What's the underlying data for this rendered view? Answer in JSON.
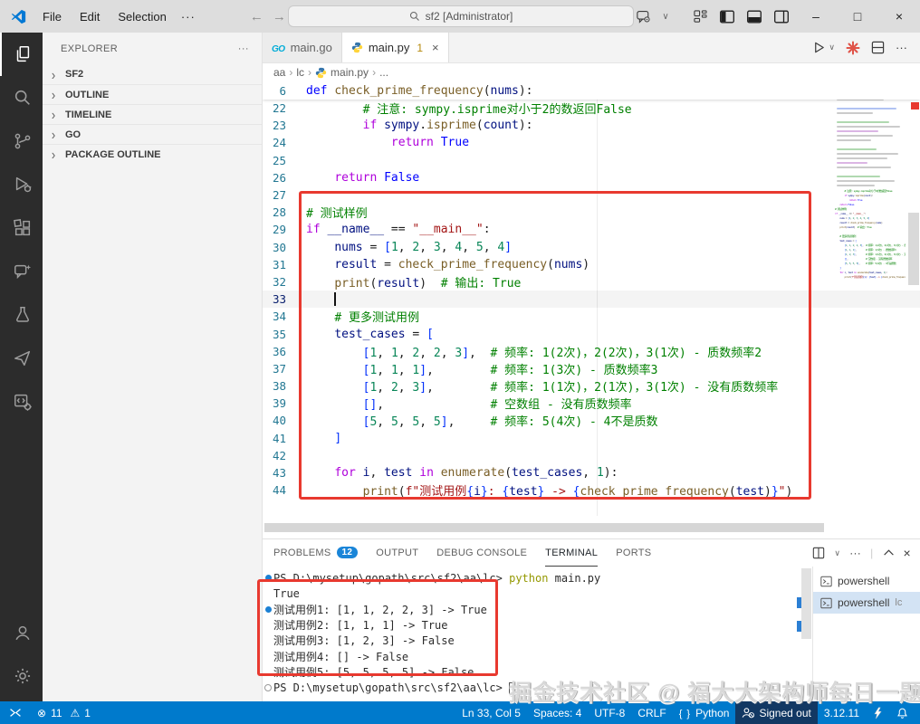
{
  "title_bar": {
    "menus": [
      "File",
      "Edit",
      "Selection"
    ],
    "menu_overflow": "···",
    "search": "sf2 [Administrator]",
    "window_buttons": [
      "minimize",
      "maximize",
      "close"
    ]
  },
  "activity_bar": {
    "items": [
      {
        "name": "explorer",
        "active": true
      },
      {
        "name": "search",
        "active": false
      },
      {
        "name": "source-control",
        "active": false
      },
      {
        "name": "run-debug",
        "active": false
      },
      {
        "name": "extensions",
        "active": false
      },
      {
        "name": "chat",
        "active": false
      },
      {
        "name": "testing",
        "active": false
      },
      {
        "name": "go",
        "active": false
      },
      {
        "name": "tools",
        "active": false
      }
    ],
    "bottom": [
      {
        "name": "accounts"
      },
      {
        "name": "settings"
      }
    ]
  },
  "sidebar": {
    "title": "EXPLORER",
    "sections": [
      "SF2",
      "OUTLINE",
      "TIMELINE",
      "GO",
      "PACKAGE OUTLINE"
    ]
  },
  "tabs": [
    {
      "label": "main.go",
      "icon": "go",
      "active": false
    },
    {
      "label": "main.py",
      "icon": "python",
      "badge": "1",
      "close": "×",
      "active": true
    }
  ],
  "breadcrumb": [
    {
      "label": "aa"
    },
    {
      "label": "lc"
    },
    {
      "label": "main.py",
      "icon": "python"
    },
    {
      "label": "..."
    }
  ],
  "editor": {
    "sticky_line": {
      "num": 6,
      "tokens": [
        [
          "k",
          "def"
        ],
        [
          "p",
          " "
        ],
        [
          "fn",
          "check_prime_frequency"
        ],
        [
          "p",
          "("
        ],
        [
          "v",
          "nums"
        ],
        [
          "p",
          "):"
        ]
      ]
    },
    "cursor_position": "Ln 33, Col 5",
    "lines": [
      {
        "num": 22,
        "tokens": [
          [
            "p",
            "        "
          ],
          [
            "c",
            "# 注意: sympy.isprime对小于2的数返回False"
          ]
        ]
      },
      {
        "num": 23,
        "tokens": [
          [
            "p",
            "        "
          ],
          [
            "f",
            "if"
          ],
          [
            "p",
            " "
          ],
          [
            "v",
            "sympy"
          ],
          [
            "p",
            "."
          ],
          [
            "fn",
            "isprime"
          ],
          [
            "p",
            "("
          ],
          [
            "v",
            "count"
          ],
          [
            "p",
            "):"
          ]
        ]
      },
      {
        "num": 24,
        "tokens": [
          [
            "p",
            "            "
          ],
          [
            "f",
            "return"
          ],
          [
            "p",
            " "
          ],
          [
            "k",
            "True"
          ]
        ]
      },
      {
        "num": 25,
        "tokens": []
      },
      {
        "num": 26,
        "tokens": [
          [
            "p",
            "    "
          ],
          [
            "f",
            "return"
          ],
          [
            "p",
            " "
          ],
          [
            "k",
            "False"
          ]
        ]
      },
      {
        "num": 27,
        "tokens": []
      },
      {
        "num": 28,
        "tokens": [
          [
            "c",
            "# 测试样例"
          ]
        ]
      },
      {
        "num": 29,
        "tokens": [
          [
            "f",
            "if"
          ],
          [
            "p",
            " "
          ],
          [
            "v",
            "__name__"
          ],
          [
            "p",
            " == "
          ],
          [
            "s",
            "\"__main__\""
          ],
          [
            "p",
            ":"
          ]
        ]
      },
      {
        "num": 30,
        "tokens": [
          [
            "p",
            "    "
          ],
          [
            "v",
            "nums"
          ],
          [
            "p",
            " = "
          ],
          [
            "b",
            "["
          ],
          [
            "n",
            "1"
          ],
          [
            "p",
            ", "
          ],
          [
            "n",
            "2"
          ],
          [
            "p",
            ", "
          ],
          [
            "n",
            "3"
          ],
          [
            "p",
            ", "
          ],
          [
            "n",
            "4"
          ],
          [
            "p",
            ", "
          ],
          [
            "n",
            "5"
          ],
          [
            "p",
            ", "
          ],
          [
            "n",
            "4"
          ],
          [
            "b",
            "]"
          ]
        ]
      },
      {
        "num": 31,
        "tokens": [
          [
            "p",
            "    "
          ],
          [
            "v",
            "result"
          ],
          [
            "p",
            " = "
          ],
          [
            "fn",
            "check_prime_frequency"
          ],
          [
            "p",
            "("
          ],
          [
            "v",
            "nums"
          ],
          [
            "p",
            ")"
          ]
        ]
      },
      {
        "num": 32,
        "tokens": [
          [
            "p",
            "    "
          ],
          [
            "fn",
            "print"
          ],
          [
            "p",
            "("
          ],
          [
            "v",
            "result"
          ],
          [
            "p",
            ")  "
          ],
          [
            "c",
            "# 输出: True"
          ]
        ]
      },
      {
        "num": 33,
        "tokens": [
          [
            "p",
            "    "
          ]
        ],
        "cursor": true,
        "active": true
      },
      {
        "num": 34,
        "tokens": [
          [
            "p",
            "    "
          ],
          [
            "c",
            "# 更多测试用例"
          ]
        ]
      },
      {
        "num": 35,
        "tokens": [
          [
            "p",
            "    "
          ],
          [
            "v",
            "test_cases"
          ],
          [
            "p",
            " = "
          ],
          [
            "b",
            "["
          ]
        ]
      },
      {
        "num": 36,
        "tokens": [
          [
            "p",
            "        "
          ],
          [
            "b",
            "["
          ],
          [
            "n",
            "1"
          ],
          [
            "p",
            ", "
          ],
          [
            "n",
            "1"
          ],
          [
            "p",
            ", "
          ],
          [
            "n",
            "2"
          ],
          [
            "p",
            ", "
          ],
          [
            "n",
            "2"
          ],
          [
            "p",
            ", "
          ],
          [
            "n",
            "3"
          ],
          [
            "b",
            "]"
          ],
          [
            "p",
            ",  "
          ],
          [
            "c",
            "# 频率: 1(2次)，2(2次)，3(1次) - 质数频率2"
          ]
        ]
      },
      {
        "num": 37,
        "tokens": [
          [
            "p",
            "        "
          ],
          [
            "b",
            "["
          ],
          [
            "n",
            "1"
          ],
          [
            "p",
            ", "
          ],
          [
            "n",
            "1"
          ],
          [
            "p",
            ", "
          ],
          [
            "n",
            "1"
          ],
          [
            "b",
            "]"
          ],
          [
            "p",
            ",        "
          ],
          [
            "c",
            "# 频率: 1(3次) - 质数频率3"
          ]
        ]
      },
      {
        "num": 38,
        "tokens": [
          [
            "p",
            "        "
          ],
          [
            "b",
            "["
          ],
          [
            "n",
            "1"
          ],
          [
            "p",
            ", "
          ],
          [
            "n",
            "2"
          ],
          [
            "p",
            ", "
          ],
          [
            "n",
            "3"
          ],
          [
            "b",
            "]"
          ],
          [
            "p",
            ",        "
          ],
          [
            "c",
            "# 频率: 1(1次)，2(1次)，3(1次) - 没有质数频率"
          ]
        ]
      },
      {
        "num": 39,
        "tokens": [
          [
            "p",
            "        "
          ],
          [
            "b",
            "[]"
          ],
          [
            "p",
            ",               "
          ],
          [
            "c",
            "# 空数组 - 没有质数频率"
          ]
        ]
      },
      {
        "num": 40,
        "tokens": [
          [
            "p",
            "        "
          ],
          [
            "b",
            "["
          ],
          [
            "n",
            "5"
          ],
          [
            "p",
            ", "
          ],
          [
            "n",
            "5"
          ],
          [
            "p",
            ", "
          ],
          [
            "n",
            "5"
          ],
          [
            "p",
            ", "
          ],
          [
            "n",
            "5"
          ],
          [
            "b",
            "]"
          ],
          [
            "p",
            ",     "
          ],
          [
            "c",
            "# 频率: 5(4次) - 4不是质数"
          ]
        ]
      },
      {
        "num": 41,
        "tokens": [
          [
            "p",
            "    "
          ],
          [
            "b",
            "]"
          ]
        ]
      },
      {
        "num": 42,
        "tokens": []
      },
      {
        "num": 43,
        "tokens": [
          [
            "p",
            "    "
          ],
          [
            "f",
            "for"
          ],
          [
            "p",
            " "
          ],
          [
            "v",
            "i"
          ],
          [
            "p",
            ", "
          ],
          [
            "v",
            "test"
          ],
          [
            "p",
            " "
          ],
          [
            "f",
            "in"
          ],
          [
            "p",
            " "
          ],
          [
            "fn",
            "enumerate"
          ],
          [
            "p",
            "("
          ],
          [
            "v",
            "test_cases"
          ],
          [
            "p",
            ", "
          ],
          [
            "n",
            "1"
          ],
          [
            "p",
            "):"
          ]
        ]
      },
      {
        "num": 44,
        "tokens": [
          [
            "p",
            "        "
          ],
          [
            "fn",
            "print"
          ],
          [
            "p",
            "("
          ],
          [
            "s",
            "f\"测试用例"
          ],
          [
            "b",
            "{"
          ],
          [
            "v",
            "i"
          ],
          [
            "b",
            "}"
          ],
          [
            "s",
            ": "
          ],
          [
            "b",
            "{"
          ],
          [
            "v",
            "test"
          ],
          [
            "b",
            "}"
          ],
          [
            "s",
            " -> "
          ],
          [
            "b",
            "{"
          ],
          [
            "fn",
            "check_prime_frequency"
          ],
          [
            "p",
            "("
          ],
          [
            "v",
            "test"
          ],
          [
            "p",
            ")"
          ],
          [
            "b",
            "}"
          ],
          [
            "s",
            "\""
          ],
          [
            "p",
            ")"
          ]
        ]
      }
    ]
  },
  "minimap": {
    "top_bars": [
      [
        30,
        "c"
      ],
      [
        52,
        "p"
      ],
      [
        0,
        "p"
      ],
      [
        66,
        "k"
      ],
      [
        40,
        "p"
      ],
      [
        0,
        "p"
      ],
      [
        58,
        "c"
      ],
      [
        70,
        "p"
      ],
      [
        46,
        "f"
      ],
      [
        62,
        "p"
      ],
      [
        38,
        "p"
      ],
      [
        0,
        "p"
      ],
      [
        44,
        "c"
      ],
      [
        68,
        "p"
      ],
      [
        56,
        "p"
      ],
      [
        34,
        "f"
      ],
      [
        60,
        "p"
      ],
      [
        0,
        "p"
      ],
      [
        48,
        "c"
      ],
      [
        64,
        "p"
      ],
      [
        42,
        "p"
      ]
    ]
  },
  "panel": {
    "tabs": [
      {
        "label": "PROBLEMS",
        "badge": "12",
        "active": false
      },
      {
        "label": "OUTPUT",
        "active": false
      },
      {
        "label": "DEBUG CONSOLE",
        "active": false
      },
      {
        "label": "TERMINAL",
        "active": true
      },
      {
        "label": "PORTS",
        "active": false
      }
    ],
    "terminal_lines": [
      {
        "deco": "dot",
        "tokens": [
          [
            "tp",
            "PS D:\\mysetup\\gopath\\src\\sf2\\aa\\lc> "
          ],
          [
            "ty",
            "python"
          ],
          [
            "tp",
            " main.py"
          ]
        ]
      },
      {
        "tokens": [
          [
            "tp",
            "True"
          ]
        ]
      },
      {
        "deco": "dot",
        "tokens": [
          [
            "tp",
            "测试用例1: [1, 1, 2, 2, 3] -> True"
          ]
        ]
      },
      {
        "tokens": [
          [
            "tp",
            "测试用例2: [1, 1, 1] -> True"
          ]
        ]
      },
      {
        "tokens": [
          [
            "tp",
            "测试用例3: [1, 2, 3] -> False"
          ]
        ]
      },
      {
        "tokens": [
          [
            "tp",
            "测试用例4: [] -> False"
          ]
        ]
      },
      {
        "tokens": [
          [
            "tp",
            "测试用例5: [5, 5, 5, 5] -> False"
          ]
        ]
      },
      {
        "deco": "circle",
        "tokens": [
          [
            "tp",
            "PS D:\\mysetup\\gopath\\src\\sf2\\aa\\lc> "
          ]
        ],
        "cursor": true
      }
    ],
    "terminal_list": [
      {
        "label": "powershell",
        "selected": false
      },
      {
        "label": "powershell",
        "suffix": "lc",
        "selected": true
      }
    ]
  },
  "status_bar": {
    "errors": "11",
    "warnings": "1",
    "right": [
      {
        "label": "Ln 33, Col 5"
      },
      {
        "label": "Spaces: 4"
      },
      {
        "label": "UTF-8"
      },
      {
        "label": "CRLF"
      },
      {
        "label": "Python",
        "icon": "braces"
      },
      {
        "label": "Signed out",
        "icon": "signed-out",
        "emphasis": true
      },
      {
        "label": "3.12.11"
      },
      {
        "label": "",
        "icon": "python-ext"
      },
      {
        "label": "",
        "icon": "bell"
      }
    ]
  },
  "watermark": {
    "text": "掘金技术社区 @ 福大大架构师每日一题"
  },
  "colors": {
    "status_bar_blue": "#007acc",
    "annotation_red": "#e8392f",
    "problems_badge_blue": "#1a85d8",
    "tab_warning_badge": "#b5890a",
    "go_icon_cyan": "#00acd7",
    "comment_green": "#008000",
    "keyword_blue": "#0000ff",
    "flow_keyword_magenta": "#af00db"
  }
}
